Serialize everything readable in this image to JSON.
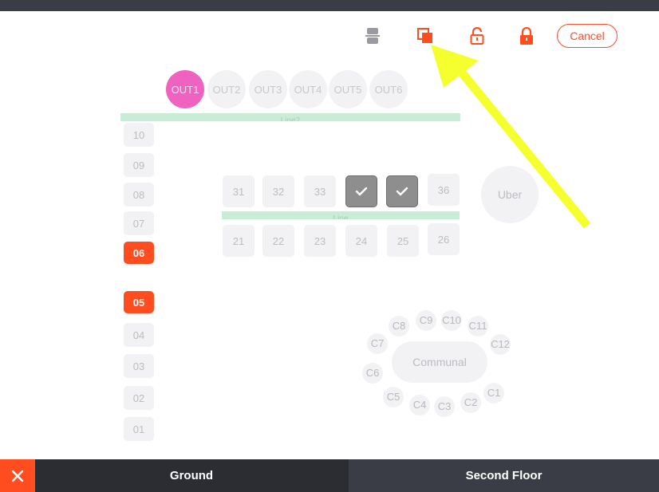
{
  "toolbar": {
    "cancel_label": "Cancel",
    "icons": [
      "split-icon",
      "copy-icon",
      "unlock-icon",
      "lock-icon"
    ]
  },
  "outs": [
    "OUT1",
    "OUT2",
    "OUT3",
    "OUT4",
    "OUT5",
    "OUT6"
  ],
  "lines": [
    "Line2",
    "Line"
  ],
  "seats": [
    "10",
    "09",
    "08",
    "07",
    "06",
    "05",
    "04",
    "03",
    "02",
    "01"
  ],
  "selected_seats": [
    "06",
    "05"
  ],
  "tables": {
    "row1": [
      "31",
      "32",
      "33",
      "",
      "",
      "36"
    ],
    "row2": [
      "21",
      "22",
      "23",
      "24",
      "25",
      "26"
    ]
  },
  "uber_label": "Uber",
  "communal": {
    "label": "Communal",
    "seats": [
      "C1",
      "C2",
      "C3",
      "C4",
      "C5",
      "C6",
      "C7",
      "C8",
      "C9",
      "C10",
      "C11",
      "C12"
    ]
  },
  "floors": {
    "ground": "Ground",
    "second": "Second Floor"
  },
  "colors": {
    "accent": "#ff4d1f",
    "active_out": "#f062c0",
    "line": "#c8ecd5",
    "arrow": "#f5ff2e",
    "checked_table": "#8e8e8e"
  }
}
